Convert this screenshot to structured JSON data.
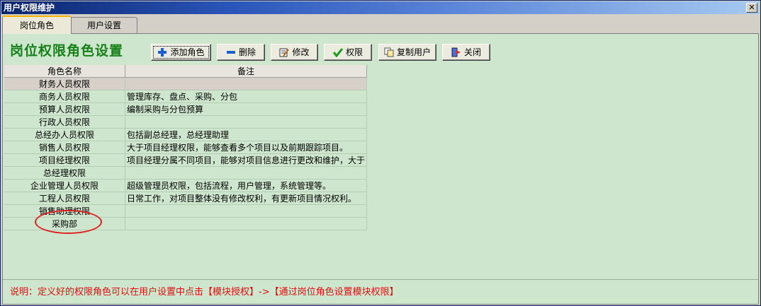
{
  "window": {
    "title": "用户权限维护",
    "close_glyph": "✕"
  },
  "tabs": [
    {
      "label": "岗位角色",
      "active": true
    },
    {
      "label": "用户设置",
      "active": false
    }
  ],
  "heading": "岗位权限角色设置",
  "toolbar": {
    "add_label": "添加角色",
    "delete_label": "删除",
    "edit_label": "修改",
    "permission_label": "权限",
    "copy_user_label": "复制用户",
    "close_label": "关闭",
    "icons": [
      "plus-icon",
      "minus-icon",
      "edit-icon",
      "check-icon",
      "copy-icon",
      "exit-icon"
    ]
  },
  "grid": {
    "columns": [
      "角色名称",
      "备注"
    ],
    "rows": [
      {
        "name": "财务人员权限",
        "note": ""
      },
      {
        "name": "商务人员权限",
        "note": "管理库存、盘点、采购、分包"
      },
      {
        "name": "预算人员权限",
        "note": "编制采购与分包预算"
      },
      {
        "name": "行政人员权限",
        "note": ""
      },
      {
        "name": "总经办人员权限",
        "note": "包括副总经理，总经理助理"
      },
      {
        "name": "销售人员权限",
        "note": "大于项目经理权限，能够查看多个项目以及前期跟踪项目。"
      },
      {
        "name": "项目经理权限",
        "note": "项目经理分属不同项目，能够对项目信息进行更改和维护，大于"
      },
      {
        "name": "总经理权限",
        "note": ""
      },
      {
        "name": "企业管理人员权限",
        "note": "超级管理员权限，包括流程，用户管理，系统管理等。"
      },
      {
        "name": "工程人员权限",
        "note": "日常工作，对项目整体没有修改权利，有更新项目情况权利。"
      },
      {
        "name": "销售助理权限",
        "note": ""
      },
      {
        "name": "采购部",
        "note": ""
      }
    ],
    "selected_row": 0
  },
  "footer_text": "说明：定义好的权限角色可以在用户设置中点击【模块授权】->【通过岗位角色设置模块权限】",
  "colors": {
    "panel_bg": "#cde6cd",
    "heading": "#188018",
    "footer_text": "#e01010",
    "annotation_circle": "#e02020",
    "title_bar": "#0a246a"
  }
}
